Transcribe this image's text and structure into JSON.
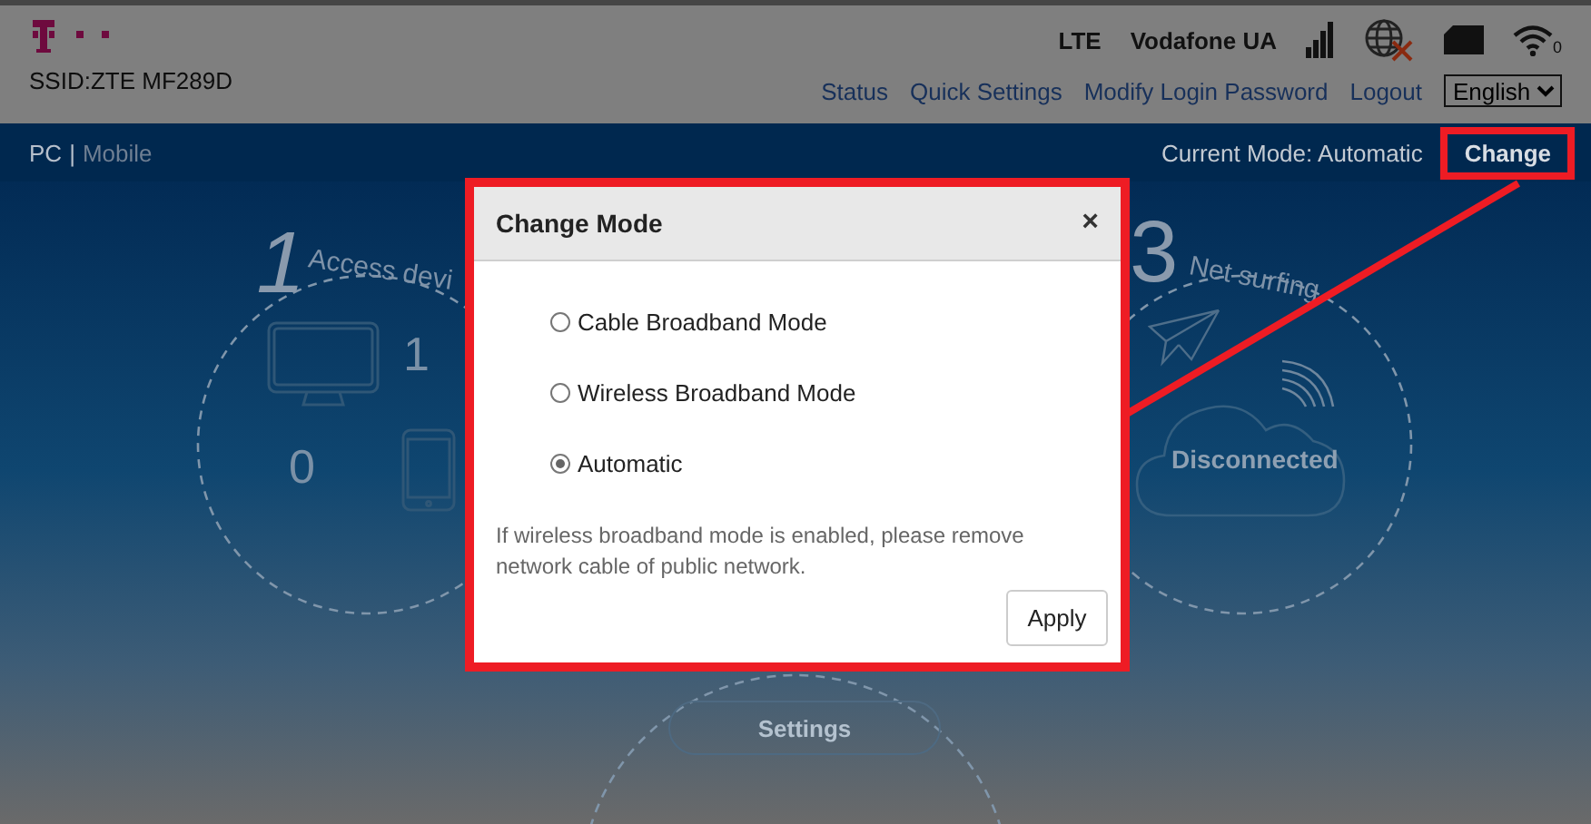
{
  "header": {
    "ssid": "SSID:ZTE MF289D",
    "network_type": "LTE",
    "operator": "Vodafone UA",
    "wifi_clients": "0",
    "nav_links": [
      "Status",
      "Quick Settings",
      "Modify Login Password",
      "Logout"
    ],
    "language": "English"
  },
  "subbar": {
    "views": [
      {
        "label": "PC",
        "selected": true
      },
      {
        "label": "Mobile",
        "selected": false
      }
    ],
    "separator": "|",
    "current_mode": "Current Mode: Automatic",
    "change_button": "Change"
  },
  "dashboard": {
    "access_step": "1",
    "access_label": "Access devi",
    "wired_count": "1",
    "wireless_count": "0",
    "net_step": "3",
    "net_label": "Net surfing",
    "connection_status": "Disconnected",
    "settings_button": "Settings"
  },
  "dialog": {
    "title": "Change Mode",
    "close": "×",
    "options": [
      {
        "label": "Cable Broadband Mode",
        "selected": false
      },
      {
        "label": "Wireless Broadband Mode",
        "selected": false
      },
      {
        "label": "Automatic",
        "selected": true
      }
    ],
    "note": "If wireless broadband mode is enabled, please remove network cable of public network.",
    "apply_button": "Apply"
  }
}
